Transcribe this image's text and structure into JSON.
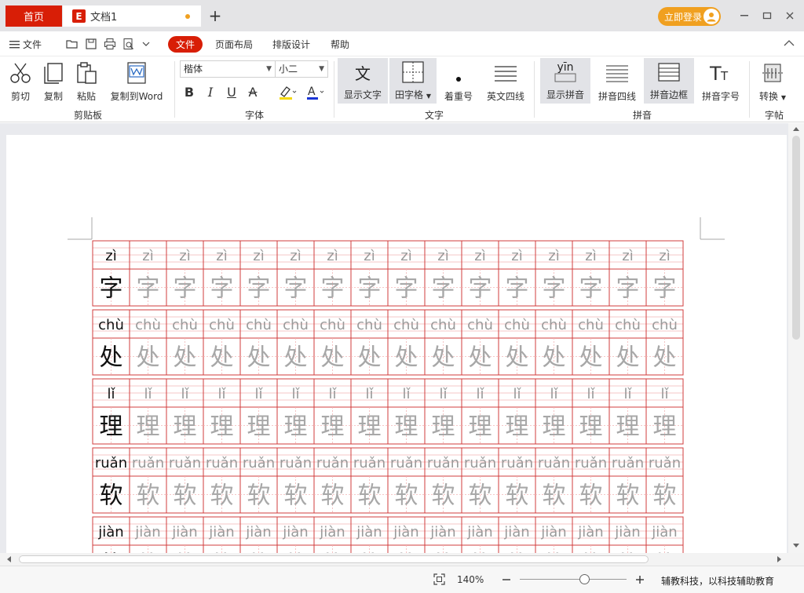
{
  "titlebar": {
    "home_tab": "首页",
    "doc_tab": "文档1",
    "doc_logo": "E",
    "login_button": "立即登录"
  },
  "menubar": {
    "file_menu": "文件",
    "tabs": [
      "文件",
      "页面布局",
      "排版设计",
      "帮助"
    ]
  },
  "ribbon": {
    "clipboard": {
      "cut": "剪切",
      "copy": "复制",
      "paste": "粘贴",
      "copy_to_word": "复制到Word",
      "group": "剪贴板"
    },
    "font": {
      "font_family": "楷体",
      "font_size": "小二",
      "group": "字体"
    },
    "text": {
      "show_text": "显示文字",
      "grid_type": "田字格",
      "emphasis": "着重号",
      "four_lines": "英文四线",
      "group": "文字",
      "show_text_icon": "文"
    },
    "pinyin": {
      "show_pinyin": "显示拼音",
      "pinyin_lines": "拼音四线",
      "pinyin_border": "拼音边框",
      "pinyin_size": "拼音字号",
      "group": "拼音",
      "show_pinyin_icon": "yīn"
    },
    "copybook": {
      "convert": "转换",
      "group": "字帖"
    }
  },
  "document": {
    "rows": [
      {
        "pinyin": "zì",
        "char": "字"
      },
      {
        "pinyin": "chù",
        "char": "处"
      },
      {
        "pinyin": "lǐ",
        "char": "理"
      },
      {
        "pinyin": "ruǎn",
        "char": "软"
      },
      {
        "pinyin": "jiàn",
        "char": "件"
      }
    ],
    "columns": 16
  },
  "statusbar": {
    "zoom": "140%",
    "zoom_level": 0.6,
    "slogan": "辅教科技，以科技辅助教育"
  },
  "colors": {
    "brand_red": "#d81e06",
    "accent_orange": "#f0a020",
    "grid_red": "#d23c3c"
  }
}
